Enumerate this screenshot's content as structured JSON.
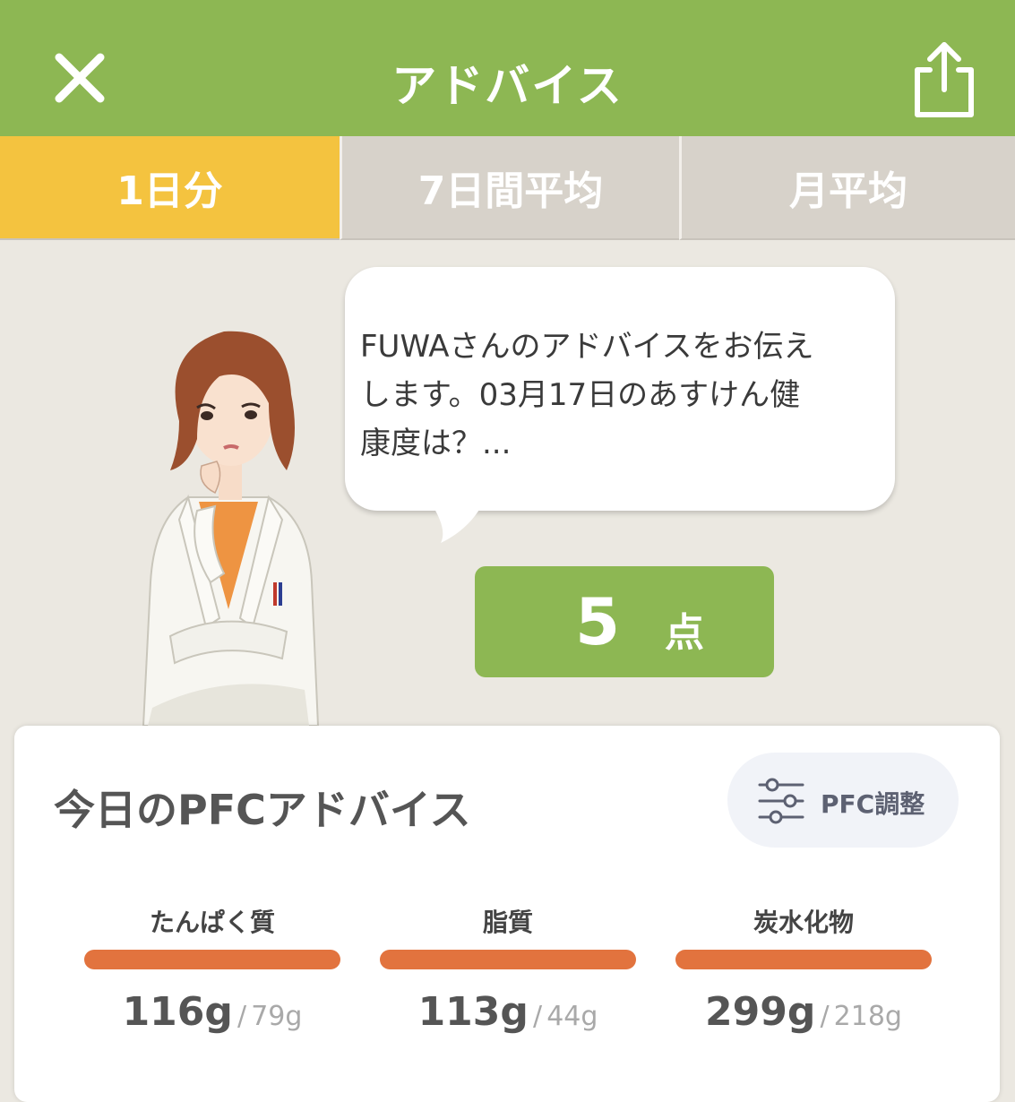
{
  "header": {
    "title": "アドバイス",
    "close_icon": "close-icon",
    "share_icon": "share-icon"
  },
  "tabs": [
    {
      "label": "1日分",
      "active": true
    },
    {
      "label": "7日間平均",
      "active": false
    },
    {
      "label": "月平均",
      "active": false
    }
  ],
  "advice": {
    "lines": [
      "FUWAさんのアドバイスをお伝え",
      "します。03月17日のあすけん健",
      "康度は？..."
    ]
  },
  "score": {
    "value": "5",
    "unit": "点"
  },
  "pfc": {
    "title": "今日のPFCアドバイス",
    "adjust_label": "PFC調整",
    "adjust_icon": "sliders-icon",
    "nutrients": [
      {
        "name": "たんぱく質",
        "actual": "116g",
        "separator": "/",
        "target": "79g"
      },
      {
        "name": "脂質",
        "actual": "113g",
        "separator": "/",
        "target": "44g"
      },
      {
        "name": "炭水化物",
        "actual": "299g",
        "separator": "/",
        "target": "218g"
      }
    ]
  },
  "colors": {
    "header": "#8db753",
    "tab_active": "#f4c33f",
    "tab_inactive": "#d7d2ca",
    "score_bg": "#8db753",
    "bar": "#e2733e",
    "background": "#ebe8e1"
  }
}
